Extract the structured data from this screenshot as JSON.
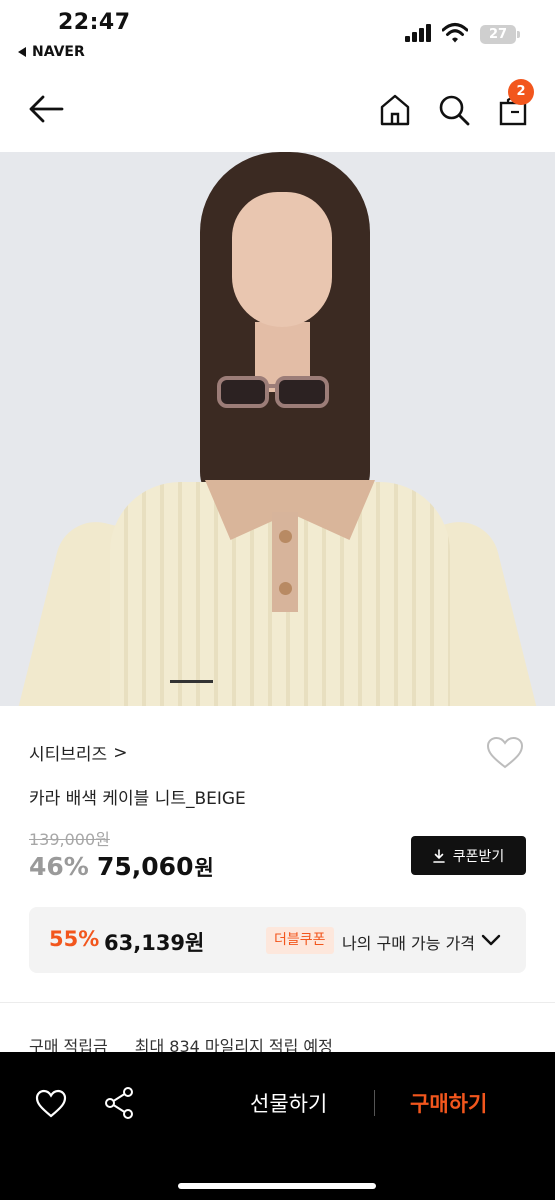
{
  "status_bar": {
    "time": "22:47",
    "back_app": "NAVER",
    "battery": "27"
  },
  "header": {
    "back_icon": "arrow-left-icon",
    "home_icon": "home-icon",
    "search_icon": "search-icon",
    "cart_icon": "shopping-bag-icon",
    "cart_count": "2"
  },
  "product": {
    "brand": "시티브리즈",
    "brand_chevron": ">",
    "title": "카라 배색 케이블 니트_BEIGE",
    "original_price": "139,000원",
    "discount": "46%",
    "sale_price": "75,060",
    "currency": "원",
    "coupon_button": "쿠폰받기"
  },
  "coupon_box": {
    "discount": "55%",
    "price": "63,139원",
    "tag": "더블쿠폰",
    "label": "나의 구매 가능 가격"
  },
  "points": {
    "label": "구매 적립금",
    "value": "최대 834 마일리지 적립 예정"
  },
  "bottom_bar": {
    "gift_label": "선물하기",
    "buy_label": "구매하기"
  },
  "colors": {
    "accent": "#f2561d",
    "dark": "#111111"
  }
}
